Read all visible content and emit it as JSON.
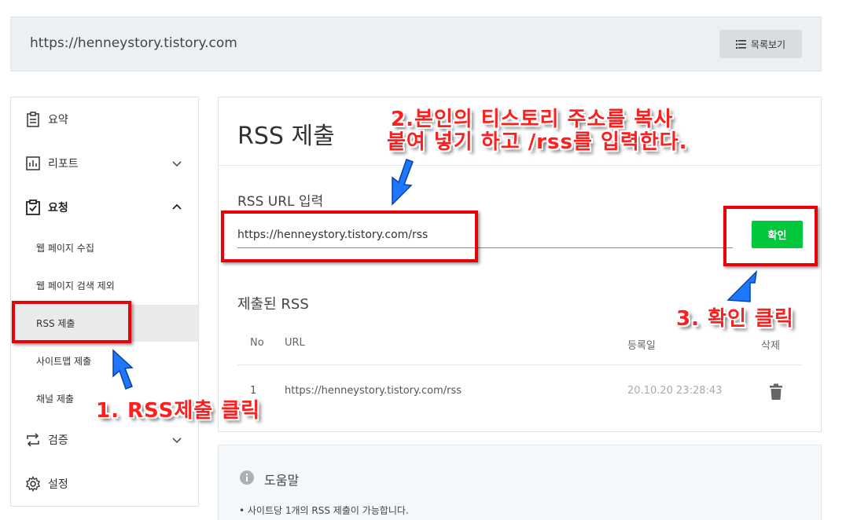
{
  "header": {
    "url": "https://henneystory.tistory.com",
    "list_button": "목록보기"
  },
  "sidebar": {
    "summary": "요약",
    "report": "리포트",
    "request": "요청",
    "sub": [
      "웹 페이지 수집",
      "웹 페이지 검색 제외",
      "RSS 제출",
      "사이트맵 제출",
      "채널 제출"
    ],
    "verify": "검증",
    "settings": "설정"
  },
  "main": {
    "title": "RSS 제출",
    "url_label": "RSS URL 입력",
    "url_value": "https://henneystory.tistory.com/rss",
    "confirm": "확인",
    "submitted_title": "제출된 RSS",
    "columns": {
      "no": "No",
      "url": "URL",
      "date": "등록일",
      "delete": "삭제"
    },
    "rows": [
      {
        "no": "1",
        "url": "https://henneystory.tistory.com/rss",
        "date": "20.10.20 23:28:43"
      }
    ]
  },
  "help": {
    "title": "도움말",
    "bullet": "• 사이트당 1개의 RSS 제출이 가능합니다."
  },
  "annotations": {
    "step1": "1. RSS제출 클릭",
    "step2_line1": "2.본인의 티스토리 주소를 복사",
    "step2_line2": "붙여 넣기 하고 /rss를 입력한다.",
    "step3": "3. 확인 클릭"
  },
  "colors": {
    "confirm_green": "#00c73c",
    "annotation_red": "#e8000b",
    "arrow_blue": "#1e78ff"
  }
}
